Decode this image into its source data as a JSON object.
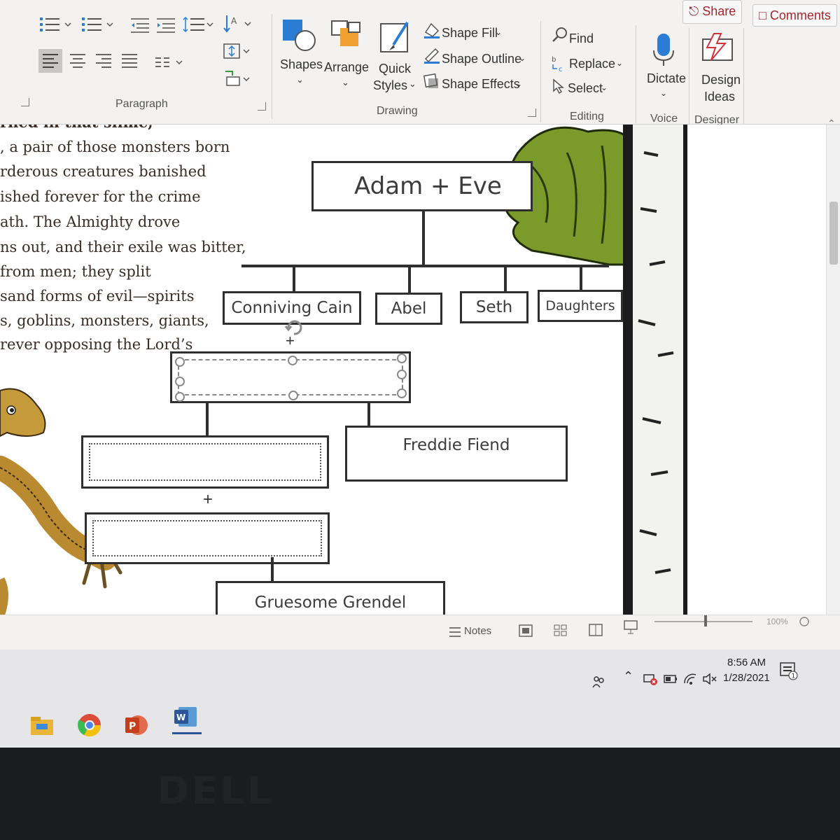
{
  "ribbon": {
    "share_label": "Share",
    "comments_label": "Comments",
    "groups": {
      "paragraph": "Paragraph",
      "drawing": "Drawing",
      "editing": "Editing",
      "voice": "Voice",
      "designer": "Designer"
    },
    "drawing": {
      "shapes": "Shapes",
      "arrange": "Arrange",
      "quick_styles_1": "Quick",
      "quick_styles_2": "Styles",
      "shape_fill": "Shape Fill",
      "shape_outline": "Shape Outline",
      "shape_effects": "Shape Effects"
    },
    "editing": {
      "find": "Find",
      "replace": "Replace",
      "select": "Select"
    },
    "voice": {
      "dictate": "Dictate"
    },
    "designer": {
      "design_1": "Design",
      "design_2": "Ideas"
    }
  },
  "document": {
    "poem_lines": [
      "rned in that slime,",
      ", a pair of those monsters born",
      "rderous creatures banished",
      "ished forever for the crime",
      "ath. The Almighty drove",
      "ns out, and their exile was bitter,",
      "from men; they split",
      "sand forms of evil—spirits",
      "s, goblins, monsters, giants,",
      "rever opposing the Lord’s"
    ],
    "tree": {
      "root": "Adam + Eve",
      "children": [
        "Conniving Cain",
        "Abel",
        "Seth",
        "Daughters"
      ],
      "fiend": "Freddie Fiend",
      "plus": "+",
      "grendel": "Gruesome Grendel"
    }
  },
  "statusbar": {
    "notes": "Notes",
    "zoom": "100%"
  },
  "taskbar": {
    "time": "8:56 AM",
    "date": "1/28/2021"
  },
  "bezel": {
    "brand": "DELL"
  },
  "colors": {
    "ribbon_bg": "#f3f2f1",
    "accent_red": "#a4262c",
    "shape_blue": "#2b7cd3",
    "shape_orange": "#f0a030",
    "tree_green": "#7a9a2a",
    "box_border": "#2f2f2f"
  }
}
